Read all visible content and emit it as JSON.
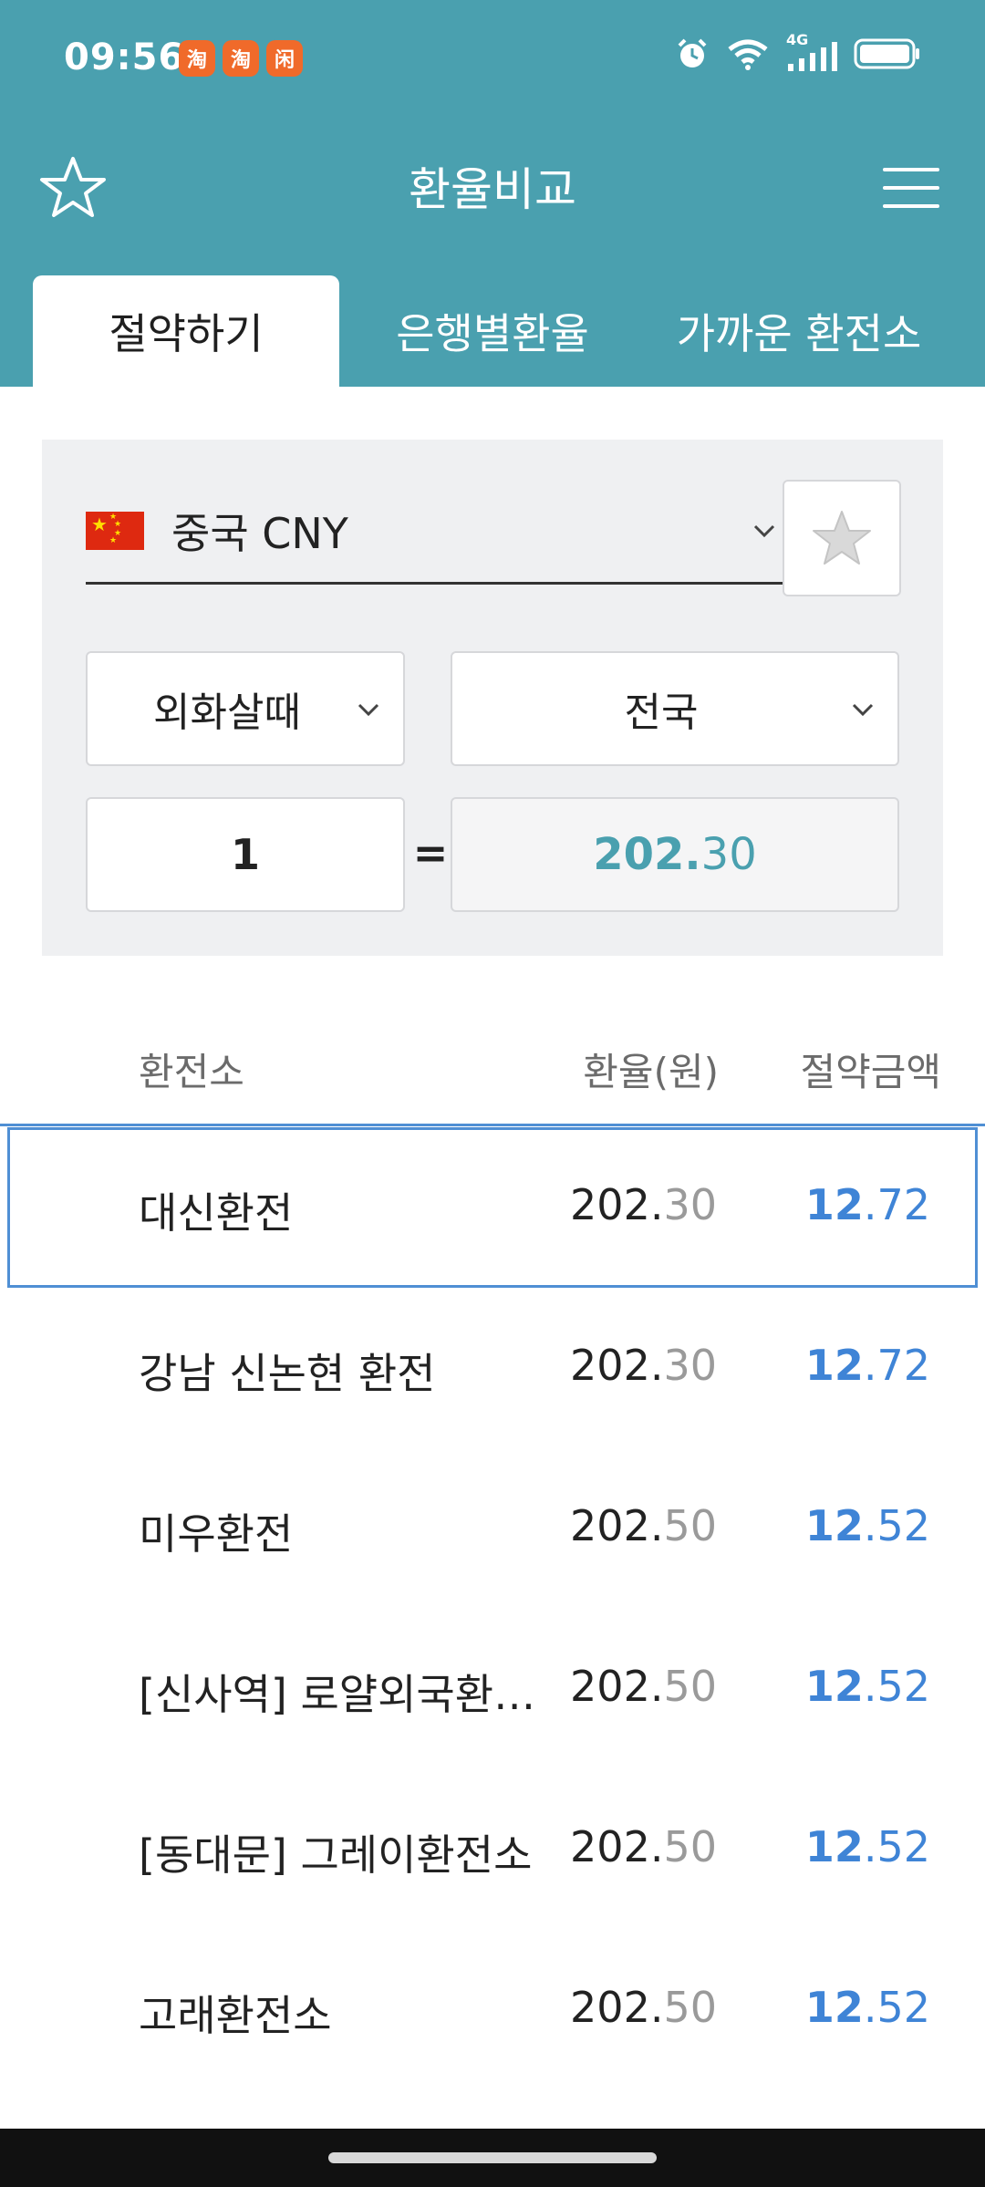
{
  "status_bar": {
    "time": "09:56",
    "notification_apps": [
      "淘",
      "淘",
      "闲"
    ],
    "network_label": "4G",
    "icons": [
      "alarm-icon",
      "wifi-icon",
      "signal-icon",
      "battery-icon"
    ]
  },
  "header": {
    "title": "환율비교",
    "favorite_icon": "star-outline-icon",
    "menu_icon": "hamburger-menu-icon"
  },
  "tabs": [
    {
      "label": "절약하기",
      "active": true
    },
    {
      "label": "은행별환율",
      "active": false
    },
    {
      "label": "가까운 환전소",
      "active": false
    }
  ],
  "converter": {
    "currency": "중국 CNY",
    "transaction_type": "외화살때",
    "region": "전국",
    "amount": "1",
    "equals": "=",
    "result_int": "202.",
    "result_dec": "30"
  },
  "list": {
    "headers": {
      "name": "환전소",
      "rate": "환율(원)",
      "saving": "절약금액"
    },
    "rows": [
      {
        "name": "대신환전",
        "rate_int": "202.",
        "rate_dec": "30",
        "save_int": "12",
        "save_dec": ".72",
        "selected": true
      },
      {
        "name": "강남 신논현 환전",
        "rate_int": "202.",
        "rate_dec": "30",
        "save_int": "12",
        "save_dec": ".72",
        "selected": false
      },
      {
        "name": "미우환전",
        "rate_int": "202.",
        "rate_dec": "50",
        "save_int": "12",
        "save_dec": ".52",
        "selected": false
      },
      {
        "name": "[신사역] 로얄외국환…",
        "rate_int": "202.",
        "rate_dec": "50",
        "save_int": "12",
        "save_dec": ".52",
        "selected": false
      },
      {
        "name": "[동대문] 그레이환전소",
        "rate_int": "202.",
        "rate_dec": "50",
        "save_int": "12",
        "save_dec": ".52",
        "selected": false
      },
      {
        "name": "고래환전소",
        "rate_int": "202.",
        "rate_dec": "50",
        "save_int": "12",
        "save_dec": ".52",
        "selected": false
      }
    ]
  },
  "colors": {
    "header_bg": "#4aa0af",
    "accent_blue": "#3f84d6",
    "card_bg": "#eff0f2"
  }
}
